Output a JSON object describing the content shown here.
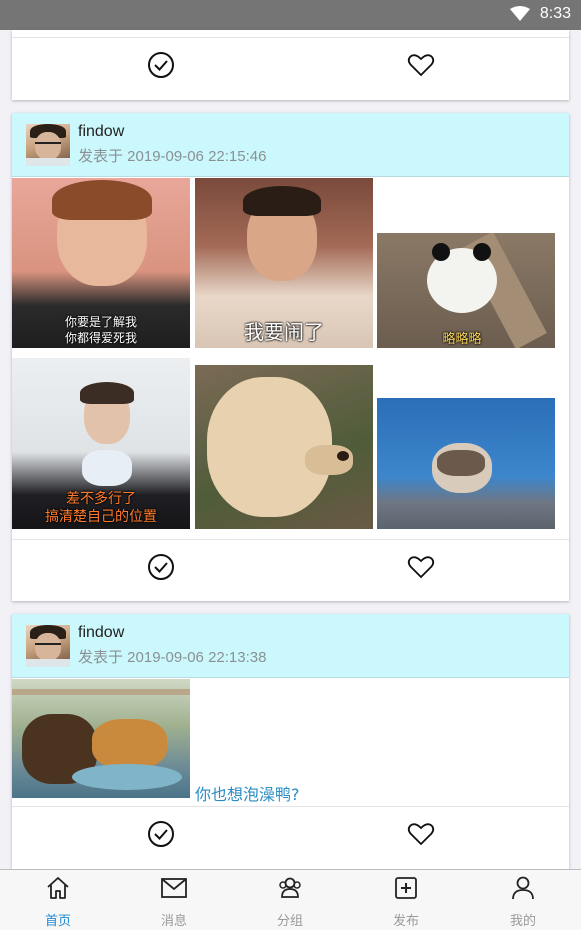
{
  "status_bar": {
    "time": "8:33"
  },
  "posts": [
    {
      "username": "findow",
      "posted_at": "发表于 2019-09-06 22:15:46",
      "captions": [
        "你要是了解我\n你都得爱死我",
        "我要闹了",
        "略略略",
        "差不多行了\n搞清楚自己的位置"
      ]
    },
    {
      "username": "findow",
      "posted_at": "发表于 2019-09-06 22:13:38",
      "text": "你也想泡澡鸭?"
    }
  ],
  "tabs": [
    {
      "label": "首页",
      "icon": "home-icon"
    },
    {
      "label": "消息",
      "icon": "mail-icon"
    },
    {
      "label": "分组",
      "icon": "group-icon"
    },
    {
      "label": "发布",
      "icon": "plus-square-icon"
    },
    {
      "label": "我的",
      "icon": "person-icon"
    }
  ],
  "active_tab": "首页",
  "colors": {
    "header_bg": "#cbf8fc",
    "accent": "#1e88d2",
    "link_text": "#2a8cc4",
    "status_bar": "#757575"
  }
}
